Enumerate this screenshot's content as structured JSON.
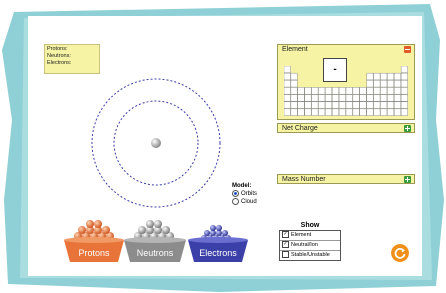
{
  "counts": {
    "protons_label": "Protons:",
    "neutrons_label": "Neutrons:",
    "electrons_label": "Electrons:"
  },
  "element_panel": {
    "title": "Element",
    "symbol": "-"
  },
  "net_charge": {
    "title": "Net Charge"
  },
  "mass_number": {
    "title": "Mass Number"
  },
  "model": {
    "label": "Model:",
    "options": [
      "Orbits",
      "Cloud"
    ],
    "selected": "Orbits"
  },
  "show": {
    "title": "Show",
    "items": [
      "Element",
      "Neutral/Ion",
      "Stable/Unstable"
    ],
    "checked": [
      true,
      true,
      false
    ]
  },
  "buckets": {
    "protons": "Protons",
    "neutrons": "Neutrons",
    "electrons": "Electrons"
  },
  "colors": {
    "proton": "#e8743a",
    "neutron": "#8c8c8c",
    "electron": "#3b3fa8",
    "panel": "#f6f3a4",
    "backdrop": "#8fd0d6"
  },
  "icons": {
    "reset": "reset-icon",
    "minus": "minus-icon",
    "plus": "plus-icon"
  }
}
